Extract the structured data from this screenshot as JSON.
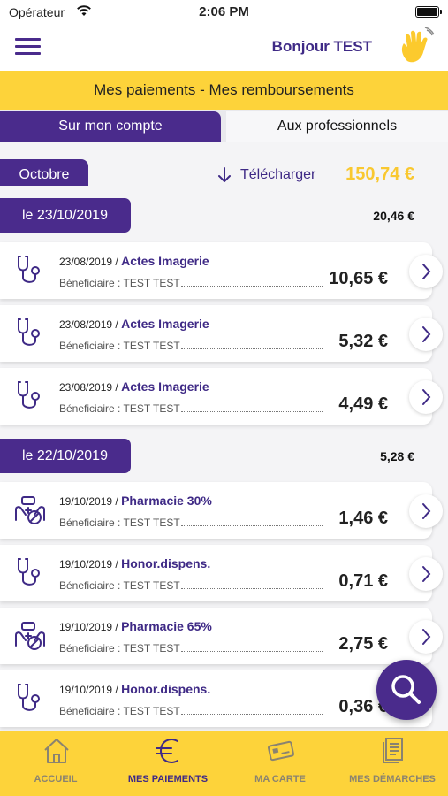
{
  "status_bar": {
    "carrier": "Opérateur",
    "time": "2:06 PM"
  },
  "header": {
    "greeting": "Bonjour TEST",
    "menu_icon": "hamburger-icon",
    "avatar_icon": "waving-hand-icon"
  },
  "banner": {
    "title": "Mes paiements - Mes remboursements"
  },
  "tabs": [
    {
      "label": "Sur mon compte",
      "active": true
    },
    {
      "label": "Aux professionnels",
      "active": false
    }
  ],
  "month": {
    "label": "Octobre",
    "download_label": "Télécharger",
    "total": "150,74 €"
  },
  "groups": [
    {
      "date": "le 23/10/2019",
      "total": "20,46 €",
      "items": [
        {
          "date": "23/08/2019",
          "separator": "/",
          "act": "Actes Imagerie",
          "beneficiary": "Béneficiaire : TEST TEST",
          "amount": "10,65 €",
          "icon": "stethoscope-icon"
        },
        {
          "date": "23/08/2019",
          "separator": "/",
          "act": "Actes Imagerie",
          "beneficiary": "Béneficiaire : TEST TEST",
          "amount": "5,32 €",
          "icon": "stethoscope-icon"
        },
        {
          "date": "23/08/2019",
          "separator": "/",
          "act": "Actes Imagerie",
          "beneficiary": "Béneficiaire : TEST TEST",
          "amount": "4,49 €",
          "icon": "stethoscope-icon"
        }
      ]
    },
    {
      "date": "le 22/10/2019",
      "total": "5,28 €",
      "items": [
        {
          "date": "19/10/2019",
          "separator": "/",
          "act": "Pharmacie 30%",
          "beneficiary": "Béneficiaire : TEST TEST",
          "amount": "1,46 €",
          "icon": "pharmacy-icon"
        },
        {
          "date": "19/10/2019",
          "separator": "/",
          "act": "Honor.dispens.",
          "beneficiary": "Béneficiaire : TEST TEST",
          "amount": "0,71 €",
          "icon": "stethoscope-icon"
        },
        {
          "date": "19/10/2019",
          "separator": "/",
          "act": "Pharmacie 65%",
          "beneficiary": "Béneficiaire : TEST TEST",
          "amount": "2,75 €",
          "icon": "pharmacy-icon"
        },
        {
          "date": "19/10/2019",
          "separator": "/",
          "act": "Honor.dispens.",
          "beneficiary": "Béneficiaire : TEST TEST",
          "amount": "0,36 €",
          "icon": "stethoscope-icon"
        }
      ]
    }
  ],
  "tabbar": [
    {
      "label": "ACCUEIL",
      "icon": "home-icon",
      "active": false
    },
    {
      "label": "MES PAIEMENTS",
      "icon": "euro-icon",
      "active": true
    },
    {
      "label": "MA CARTE",
      "icon": "card-icon",
      "active": false
    },
    {
      "label": "MES DÉMARCHES",
      "icon": "documents-icon",
      "active": false
    }
  ],
  "colors": {
    "primary": "#4a2b8c",
    "accent": "#fdd33a",
    "amount_highlight": "#f9c830"
  }
}
